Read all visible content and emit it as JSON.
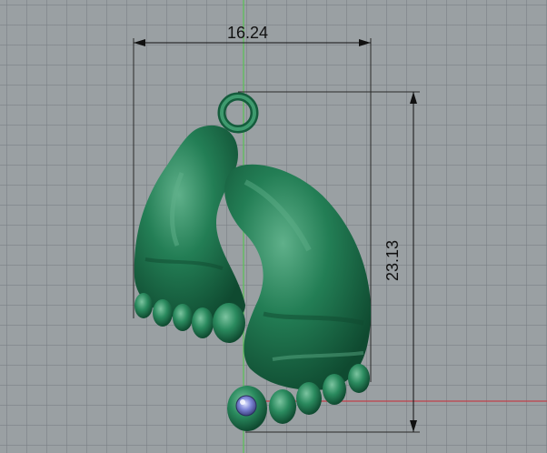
{
  "viewport": {
    "background": "#9aa0a3",
    "grid_color": "#7d8286",
    "axis_green": "#5dc05a",
    "axis_red": "#c0404a",
    "model_color": "#1f7a52"
  },
  "dimensions": {
    "width_value": "16.24",
    "height_value": "23.13"
  }
}
